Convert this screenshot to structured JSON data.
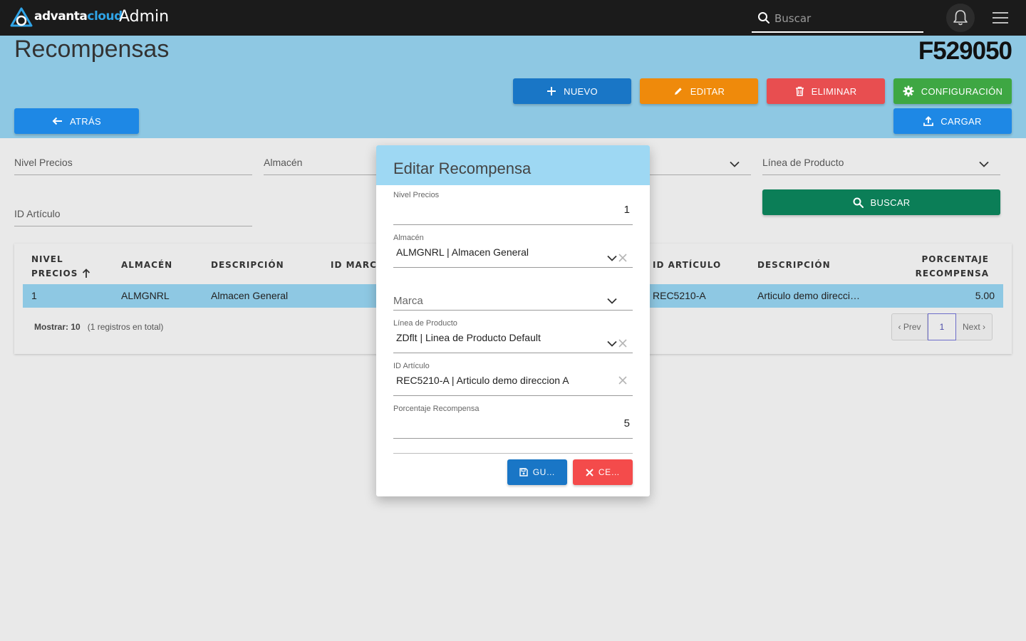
{
  "topbar": {
    "brand_part1": "advanta",
    "brand_part2": "cloud",
    "section": "Admin",
    "search_placeholder": "Buscar",
    "accent_color": "#2fa3e6"
  },
  "header": {
    "title": "Recompensas",
    "company_code": "F529050"
  },
  "actions": {
    "nuevo": "NUEVO",
    "editar": "EDITAR",
    "eliminar": "ELIMINAR",
    "configuracion": "CONFIGURACIÓN",
    "atras": "ATRÁS",
    "cargar": "CARGAR",
    "buscar": "BUSCAR"
  },
  "filters": {
    "nivel_precios": "Nivel Precios",
    "almacen": "Almacén",
    "linea_producto": "Línea de Producto",
    "id_articulo": "ID Artículo"
  },
  "table": {
    "headers": {
      "nivel_l1": "NIVEL",
      "nivel_l2": "PRECIOS",
      "almacen": "ALMACÉN",
      "descripcion": "DESCRIPCIÓN",
      "id_marca": "ID MARCA",
      "id_articulo": "ID ARTÍCULO",
      "descripcion2": "DESCRIPCIÓN",
      "porcentaje_l1": "PORCENTAJE",
      "porcentaje_l2": "RECOMPENSA"
    },
    "rows": [
      {
        "nivel": "1",
        "almacen": "ALMGNRL",
        "descripcion": "Almacen General",
        "id_articulo": "REC5210-A",
        "descripcion2": "Articulo demo direcci…",
        "porcentaje": "5.00"
      }
    ],
    "footer": {
      "mostrar": "Mostrar: 10",
      "total": "(1 registros en total)"
    },
    "pager": {
      "prev": "‹ Prev",
      "current": "1",
      "next": "Next ›"
    }
  },
  "modal": {
    "title": "Editar Recompensa",
    "fields": {
      "nivel_label": "Nivel Precios",
      "nivel_value": "1",
      "almacen_label": "Almacén",
      "almacen_value": "ALMGNRL | Almacen General",
      "marca_placeholder": "Marca",
      "linea_label": "Línea de Producto",
      "linea_value": "ZDflt | Linea de Producto Default",
      "articulo_label": "ID Artículo",
      "articulo_value": "REC5210-A | Articulo demo direccion A",
      "porcentaje_label": "Porcentaje Recompensa",
      "porcentaje_value": "5"
    },
    "save": "GU…",
    "cancel": "CE…"
  }
}
